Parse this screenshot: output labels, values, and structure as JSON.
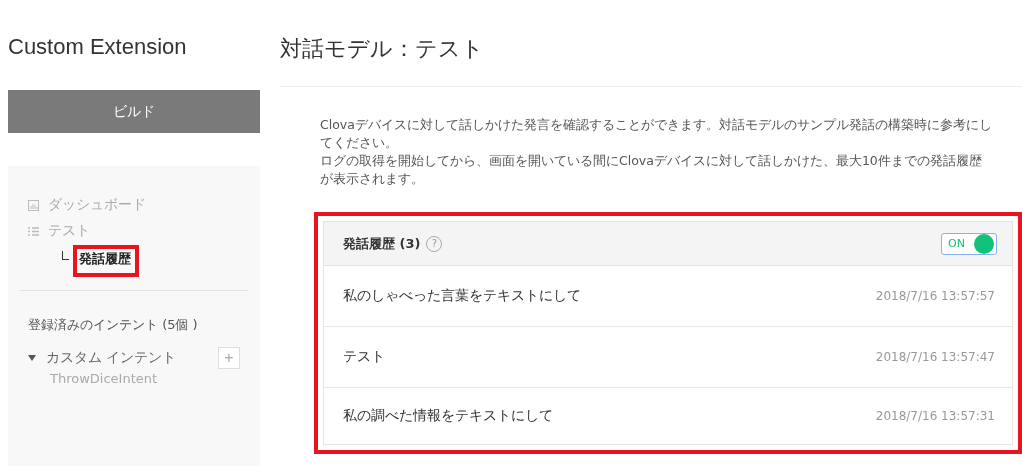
{
  "sidebar": {
    "title": "Custom Extension",
    "build_button": "ビルド",
    "nav": [
      {
        "label": "ダッシュボード",
        "kind": "chart"
      },
      {
        "label": "テスト",
        "kind": "list",
        "children": [
          {
            "label": "発話履歴",
            "selected": true,
            "highlighted": true
          }
        ]
      }
    ],
    "intents_heading": "登録済みのインテント (5個 )",
    "intent_groups": [
      {
        "label": "カスタム インテント",
        "expanded": true,
        "add_button": "+",
        "items": [
          "ThrowDiceIntent"
        ]
      }
    ]
  },
  "main": {
    "title": "対話モデル：テスト",
    "description": [
      "Clovaデバイスに対して話しかけた発言を確認することができます。対話モデルのサンプル発話の構築時に参考にしてください。",
      "ログの取得を開始してから、画面を開いている間にClovaデバイスに対して話しかけた、最大10件までの発話履歴が表示されます。"
    ],
    "history": {
      "title": "発話履歴 (3)",
      "help": "?",
      "highlighted": true,
      "toggle": {
        "label": "ON",
        "on": true
      },
      "rows": [
        {
          "text": "私のしゃべった言葉をテキストにして",
          "time": "2018/7/16 13:57:57"
        },
        {
          "text": "テスト",
          "time": "2018/7/16 13:57:47"
        },
        {
          "text": "私の調べた情報をテキストにして",
          "time": "2018/7/16 13:57:31"
        }
      ]
    }
  }
}
